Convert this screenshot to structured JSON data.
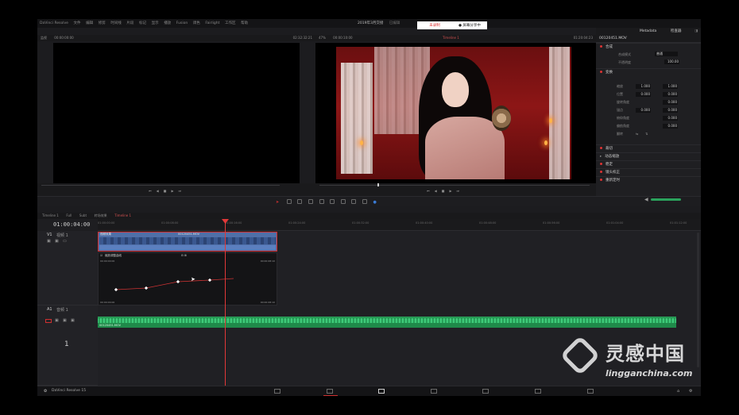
{
  "menu": {
    "app_name": "DaVinci Resolve",
    "items": [
      "文件",
      "编辑",
      "修剪",
      "时间线",
      "片段",
      "标记",
      "显示",
      "播放",
      "Fusion",
      "调色",
      "Fairlight",
      "工作区",
      "帮助"
    ]
  },
  "notice": {
    "left": "未录制",
    "right": "● 屏幕分享中"
  },
  "title": {
    "project": "2019年3月交接",
    "status": "已编辑"
  },
  "source_viewer": {
    "label": "监视",
    "timecode_left": "00:00:00:00",
    "timecode_right": "02:32:32:21"
  },
  "timeline_viewer": {
    "zoom": "47%",
    "timecode_left": "00:00:10:00",
    "name": "Timeline 1",
    "timecode_right": "01:20:04:23"
  },
  "inspector": {
    "top_buttons": {
      "metadata": "Metadata",
      "inspector": "检查器"
    },
    "clip_name": "00120451.MOV",
    "sections": {
      "composite": "合成",
      "transform": "变换",
      "cropping": "裁切",
      "dynamic_zoom": "动态缩放",
      "stabilization": "稳定",
      "lens_correction": "镜头校正",
      "retime_scaling": "重新定时"
    },
    "composite_rows": [
      {
        "label": "合成模式",
        "value": "普通"
      },
      {
        "label": "不透明度",
        "value": "100.00"
      }
    ],
    "transform_rows": [
      {
        "label": "缩放",
        "x": "1.000",
        "y": "1.000"
      },
      {
        "label": "位置",
        "x": "0.000",
        "y": "0.000"
      },
      {
        "label": "旋转角度",
        "x": "0.000"
      },
      {
        "label": "锚点",
        "x": "0.000",
        "y": "0.000"
      },
      {
        "label": "俯仰角度",
        "x": "0.000"
      },
      {
        "label": "偏航角度",
        "x": "0.000"
      },
      {
        "label": "翻转",
        "x": ""
      }
    ]
  },
  "timeline": {
    "tabs": [
      "Timeline 1",
      "Full",
      "Subt",
      "转场效果",
      "Timeline 1"
    ],
    "timecode": "01:00:04:00",
    "ruler_ticks": [
      "01:00:00:00",
      "01:00:08:00",
      "01:00:16:00",
      "01:00:24:00",
      "01:00:32:00",
      "01:00:40:00",
      "01:00:48:00",
      "01:00:56:00",
      "01:01:04:00",
      "01:01:12:00"
    ],
    "video_track": {
      "id": "V1",
      "name": "视频 1",
      "clip_title": "00120451.MOV",
      "clip_tag": "视频效果"
    },
    "curve_panel": {
      "label": "缩放调整曲线",
      "tc_start": "00:00:00:00",
      "tc_end": "00:00:08:10",
      "tc_bottom_left": "00:00:00:00",
      "tc_bottom_right": "00:00:08:10"
    },
    "audio_track": {
      "id": "A1",
      "name": "音频 1",
      "clip_name": "00120451.MOV"
    },
    "track_number": "1"
  },
  "bottom": {
    "app_label": "DaVinci Resolve 15"
  },
  "watermark": {
    "cn": "灵感中国",
    "en": "lingganchina.com"
  },
  "colors": {
    "accent": "#d03030",
    "audio": "#1f8a4a",
    "clip": "#4f6fa8"
  }
}
